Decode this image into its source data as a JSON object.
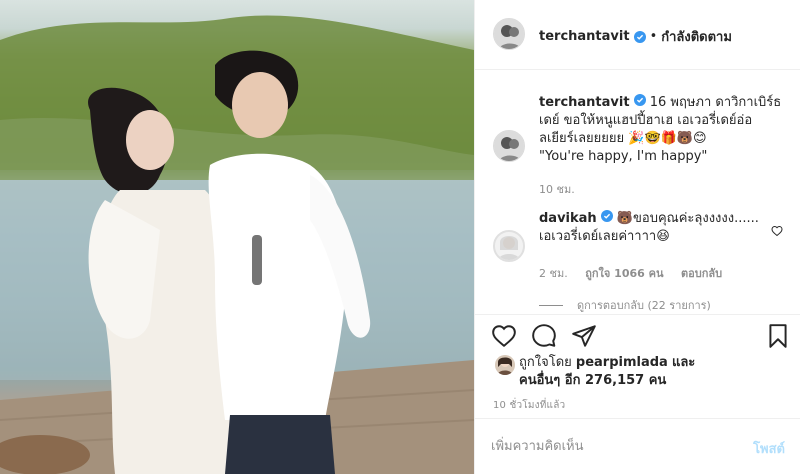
{
  "post": {
    "photo_alt": "couple on a wooden pier by the sea",
    "header": {
      "username": "terchantavit",
      "separator": "•",
      "follow_status": "กำลังติดตาม"
    },
    "caption": {
      "username": "terchantavit",
      "text_line1": "16 พฤษภา ดาวิกาเบิร์ธ",
      "text_line2": "เดย์ ขอให้หนูแฮปปี้ฮาเฮ เอเวอรี่เดย์อ่อ",
      "text_line3": "ลเยียร์เลยยยยย 🎉🤓🎁🐻😊",
      "text_line4": "\"You're happy, I'm happy\"",
      "time": "10 ชม."
    },
    "comment": {
      "username": "davikah",
      "text_line1": "🐻ขอบคุณค่ะลุงงงงง......",
      "text_line2": "เอเวอรี่เดย์เลยค่าาาา😆",
      "time": "2 ชม.",
      "likes": "ถูกใจ 1066 คน",
      "reply": "ตอบกลับ",
      "view_replies": "ดูการตอบกลับ (22 รายการ)"
    },
    "likes": {
      "prefix": "ถูกใจโดย",
      "user": "pearpimlada",
      "and": "และ",
      "others": "คนอื่นๆ อีก 276,157 คน"
    },
    "timestamp": "10 ชั่วโมงที่แล้ว",
    "composer": {
      "placeholder": "เพิ่มความคิดเห็น",
      "post_label": "โพสต์"
    }
  },
  "icons": {
    "verified": "verified-badge-icon",
    "like": "heart-icon",
    "comment": "comment-bubble-icon",
    "share": "paper-plane-icon",
    "save": "bookmark-icon"
  },
  "colors": {
    "verified": "#3897f0",
    "text": "#262626",
    "muted": "#8e8e8e",
    "post_button": "#b2dffc"
  }
}
